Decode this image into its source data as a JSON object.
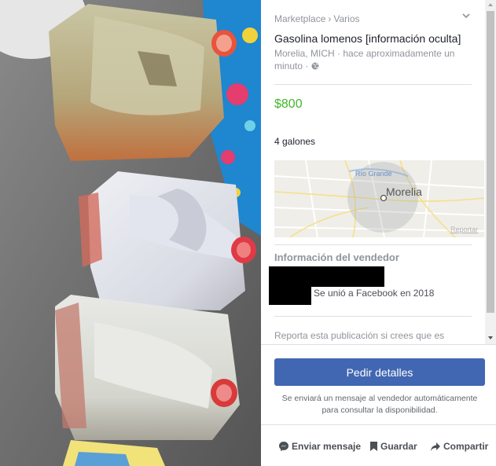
{
  "breadcrumb": {
    "root": "Marketplace",
    "separator": "›",
    "category": "Varios"
  },
  "listing": {
    "title": "Gasolina lomenos [información oculta]",
    "location": "Morelia, MICH",
    "time": "hace aproximadamente un minuto",
    "privacy_icon": "globe-icon",
    "price": "$800",
    "description": "4 galones"
  },
  "map": {
    "city_label": "Morelia",
    "river_label": "Río Grande",
    "report_link": "Reportar"
  },
  "seller": {
    "heading": "Información del vendedor",
    "joined": "Se unió a Facebook en 2018"
  },
  "report_text": "Reporta esta publicación si crees que es",
  "cta": {
    "button_label": "Pedir detalles",
    "note": "Se enviará un mensaje al vendedor automáticamente para consultar la disponibilidad."
  },
  "actions": [
    {
      "label": "Enviar mensaje",
      "icon": "messenger-icon"
    },
    {
      "label": "Guardar",
      "icon": "bookmark-icon"
    },
    {
      "label": "Compartir",
      "icon": "share-arrow-icon"
    }
  ],
  "colors": {
    "price": "#42b72a",
    "button": "#4267b2"
  }
}
